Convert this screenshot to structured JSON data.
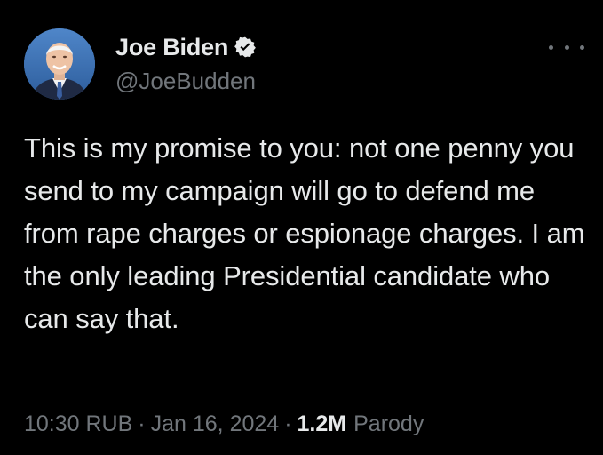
{
  "author": {
    "display_name": "Joe Biden",
    "handle": "@JoeBudden",
    "verified": true,
    "avatar": "portrait-photo"
  },
  "tweet": {
    "text": "This is my promise to you: not one penny you send to my campaign will go to defend me from rape charges or espionage charges. I am the only leading Presidential candidate who can say that."
  },
  "meta": {
    "time": "10:30 RUB",
    "separator": "·",
    "date": "Jan 16, 2024",
    "views": "1.2M",
    "views_label": "Parody"
  },
  "icons": {
    "verified": "verified-badge-icon",
    "more": "more-options-icon"
  },
  "colors": {
    "background": "#000000",
    "text": "#e7e9ea",
    "secondary": "#71767b"
  }
}
